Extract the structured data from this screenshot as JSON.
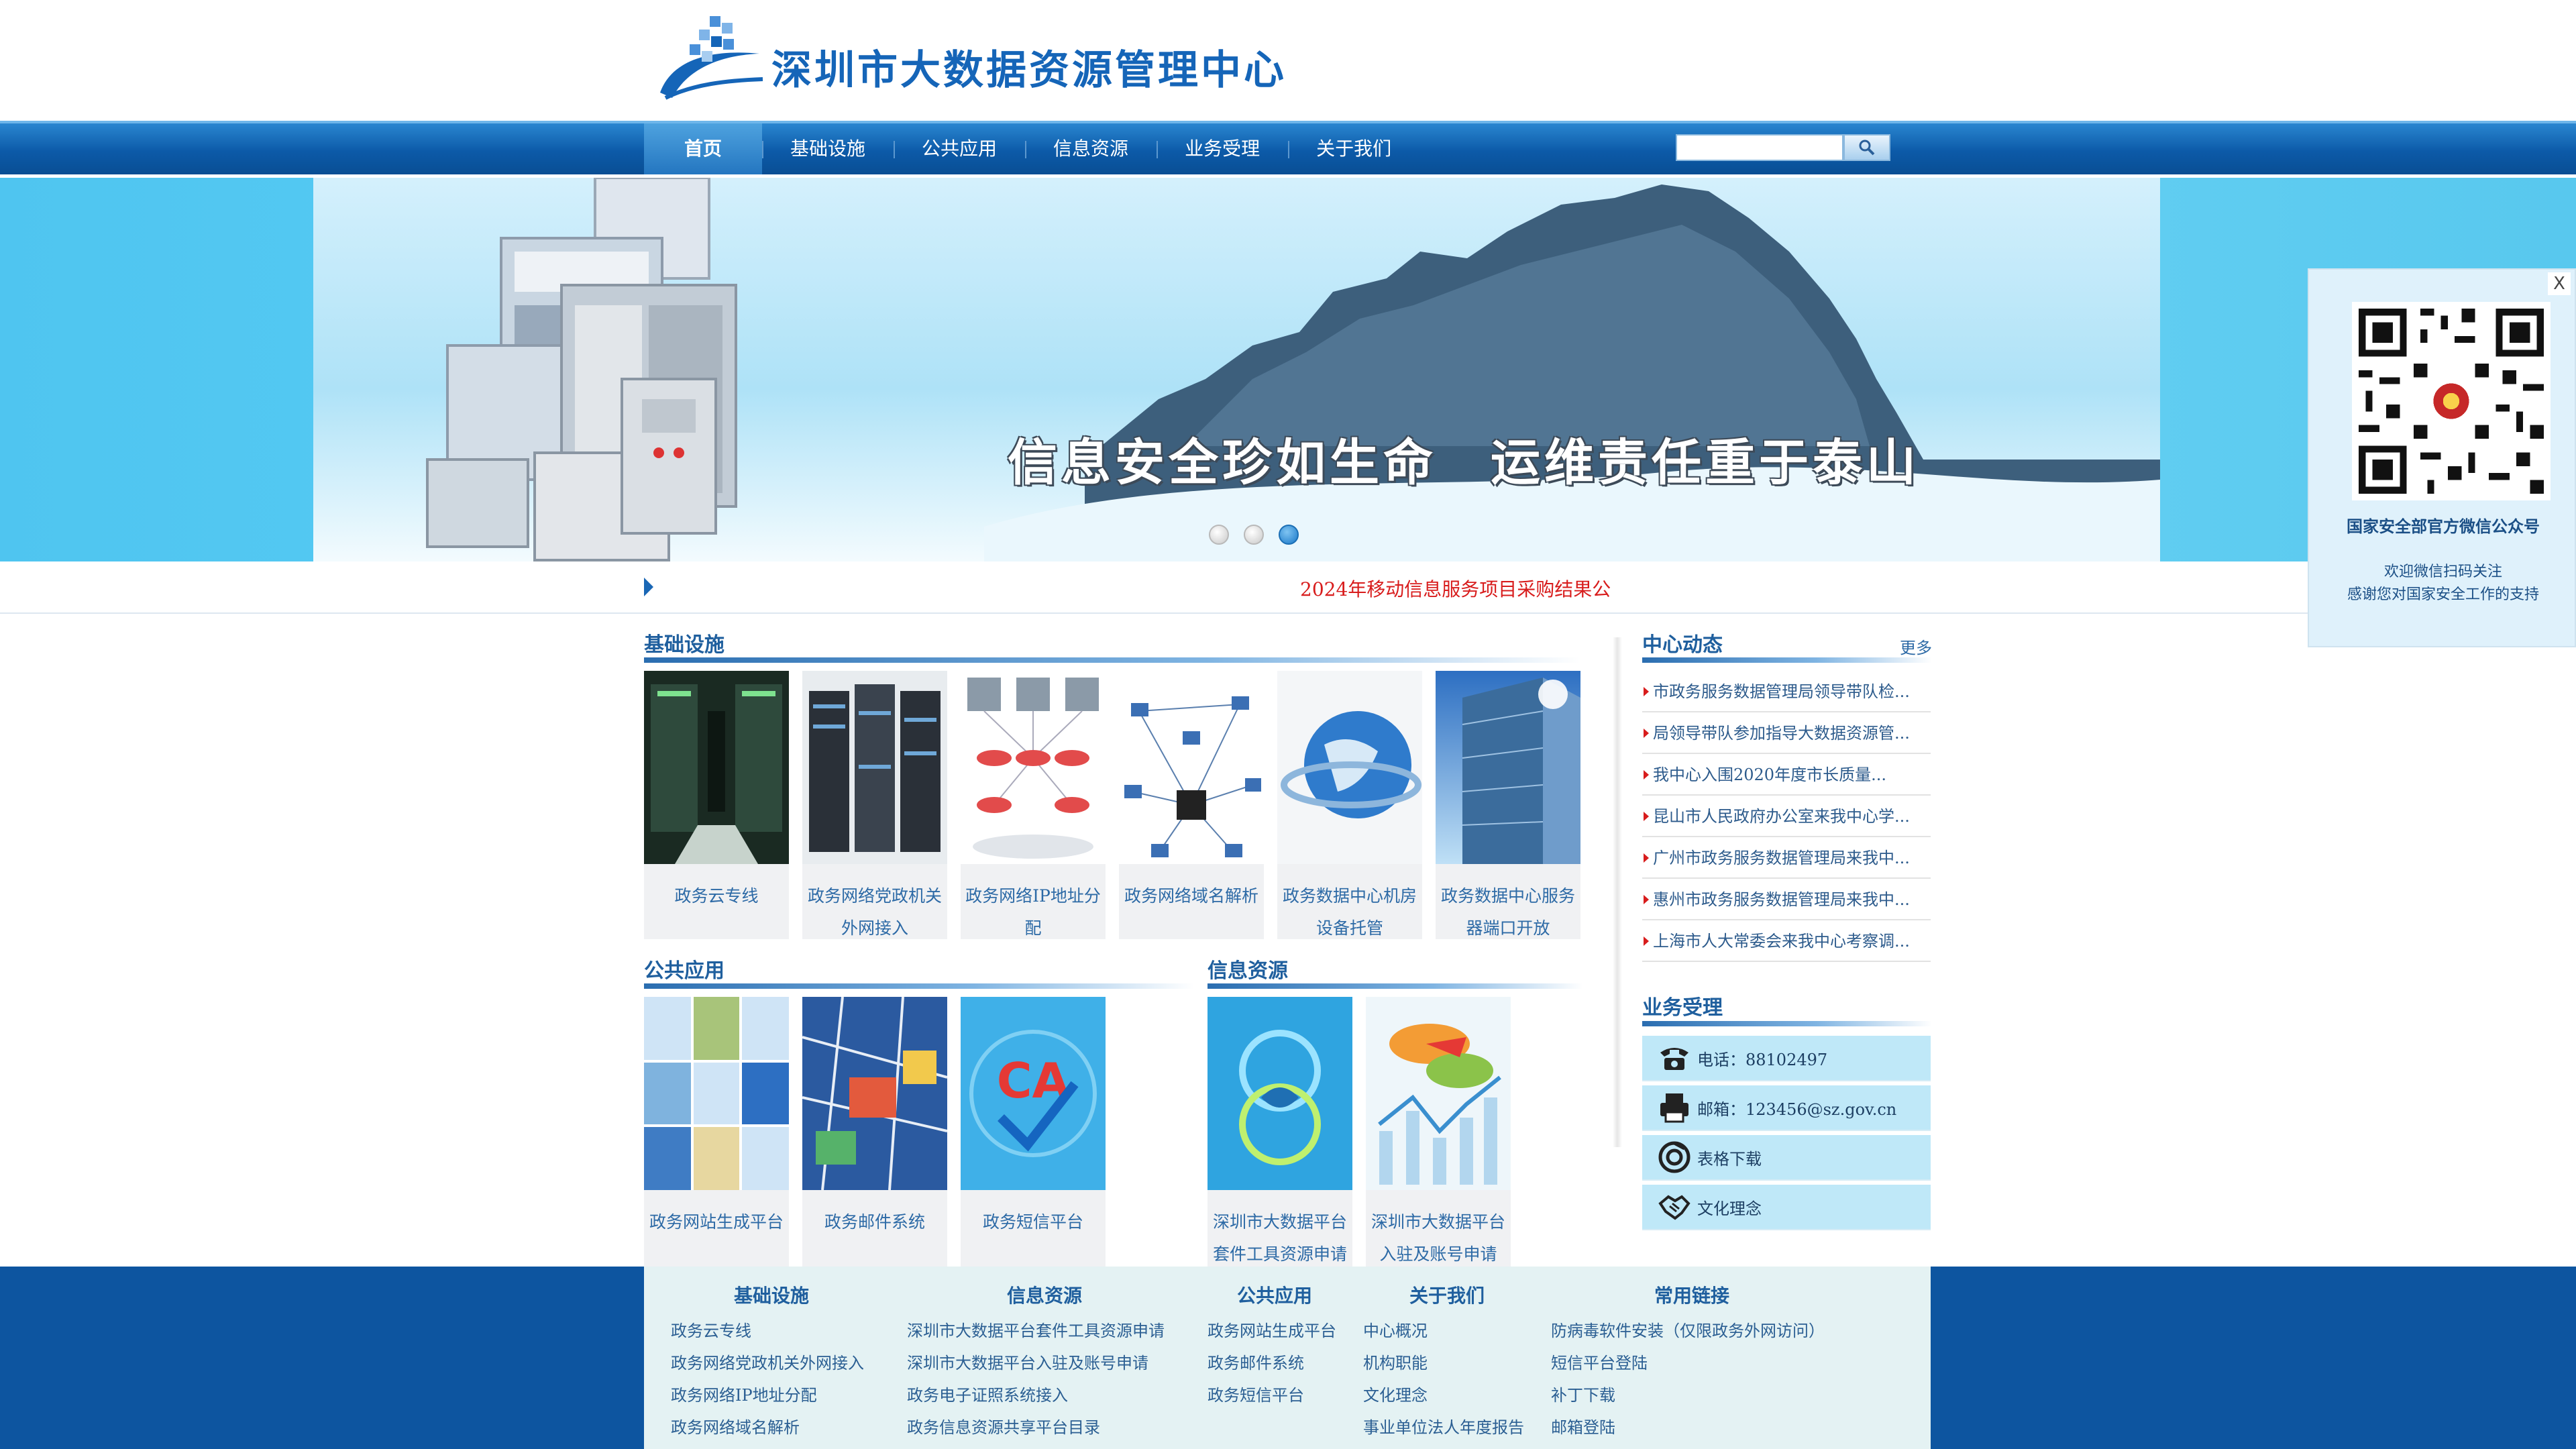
{
  "site": {
    "logo_text": "深圳市大数据资源管理中心"
  },
  "nav": {
    "items": [
      "首页",
      "基础设施",
      "公共应用",
      "信息资源",
      "业务受理",
      "关于我们"
    ],
    "search_placeholder": ""
  },
  "banner": {
    "slogan": "信息安全珍如生命　运维责任重于泰山",
    "slides": 3,
    "active_slide": 3
  },
  "ticker": {
    "text": "2024年移动信息服务项目采购结果公"
  },
  "infra": {
    "title": "基础设施",
    "tiles": [
      {
        "caption": "政务云专线"
      },
      {
        "caption": "政务网络党政机关外网接入"
      },
      {
        "caption": "政务网络IP地址分配"
      },
      {
        "caption": "政务网络域名解析"
      },
      {
        "caption": "政务数据中心机房设备托管"
      },
      {
        "caption": "政务数据中心服务器端口开放"
      }
    ]
  },
  "public_apps": {
    "title": "公共应用",
    "tiles": [
      {
        "caption": "政务网站生成平台"
      },
      {
        "caption": "政务邮件系统"
      },
      {
        "caption": "政务短信平台"
      }
    ]
  },
  "info_resources": {
    "title": "信息资源",
    "tiles": [
      {
        "caption": "深圳市大数据平台套件工具资源申请"
      },
      {
        "caption": "深圳市大数据平台入驻及账号申请"
      }
    ]
  },
  "news": {
    "title": "中心动态",
    "more": "更多",
    "items": [
      "市政务服务数据管理局领导带队检...",
      "局领导带队参加指导大数据资源管...",
      "我中心入围2020年度市长质量...",
      "昆山市人民政府办公室来我中心学...",
      "广州市政务服务数据管理局来我中...",
      "惠州市政务服务数据管理局来我中...",
      "上海市人大常委会来我中心考察调..."
    ]
  },
  "business": {
    "title": "业务受理",
    "items": [
      {
        "icon": "phone-icon",
        "label": "电话：88102497"
      },
      {
        "icon": "printer-icon",
        "label": "邮箱：123456@sz.gov.cn"
      },
      {
        "icon": "download-icon",
        "label": "表格下载"
      },
      {
        "icon": "handshake-icon",
        "label": "文化理念"
      }
    ]
  },
  "footer": {
    "columns": [
      {
        "title": "基础设施",
        "links": [
          "政务云专线",
          "政务网络党政机关外网接入",
          "政务网络IP地址分配",
          "政务网络域名解析"
        ]
      },
      {
        "title": "信息资源",
        "links": [
          "深圳市大数据平台套件工具资源申请",
          "深圳市大数据平台入驻及账号申请",
          "政务电子证照系统接入",
          "政务信息资源共享平台目录"
        ]
      },
      {
        "title": "公共应用",
        "links": [
          "政务网站生成平台",
          "政务邮件系统",
          "政务短信平台"
        ]
      },
      {
        "title": "关于我们",
        "links": [
          "中心概况",
          "机构职能",
          "文化理念",
          "事业单位法人年度报告"
        ]
      },
      {
        "title": "常用链接",
        "links": [
          "防病毒软件安装（仅限政务外网访问）",
          "短信平台登陆",
          "补丁下载",
          "邮箱登陆"
        ]
      }
    ]
  },
  "qr_popup": {
    "close": "X",
    "title": "国家安全部官方微信公众号",
    "line1": "欢迎微信扫码关注",
    "line2": "感谢您对国家安全工作的支持"
  },
  "colors": {
    "brand_blue": "#0d55a0",
    "nav_blue": "#0c5aa8",
    "link_blue": "#2d6aa6",
    "ticker_red": "#d81c1c",
    "banner_cyan": "#58ccf4"
  }
}
